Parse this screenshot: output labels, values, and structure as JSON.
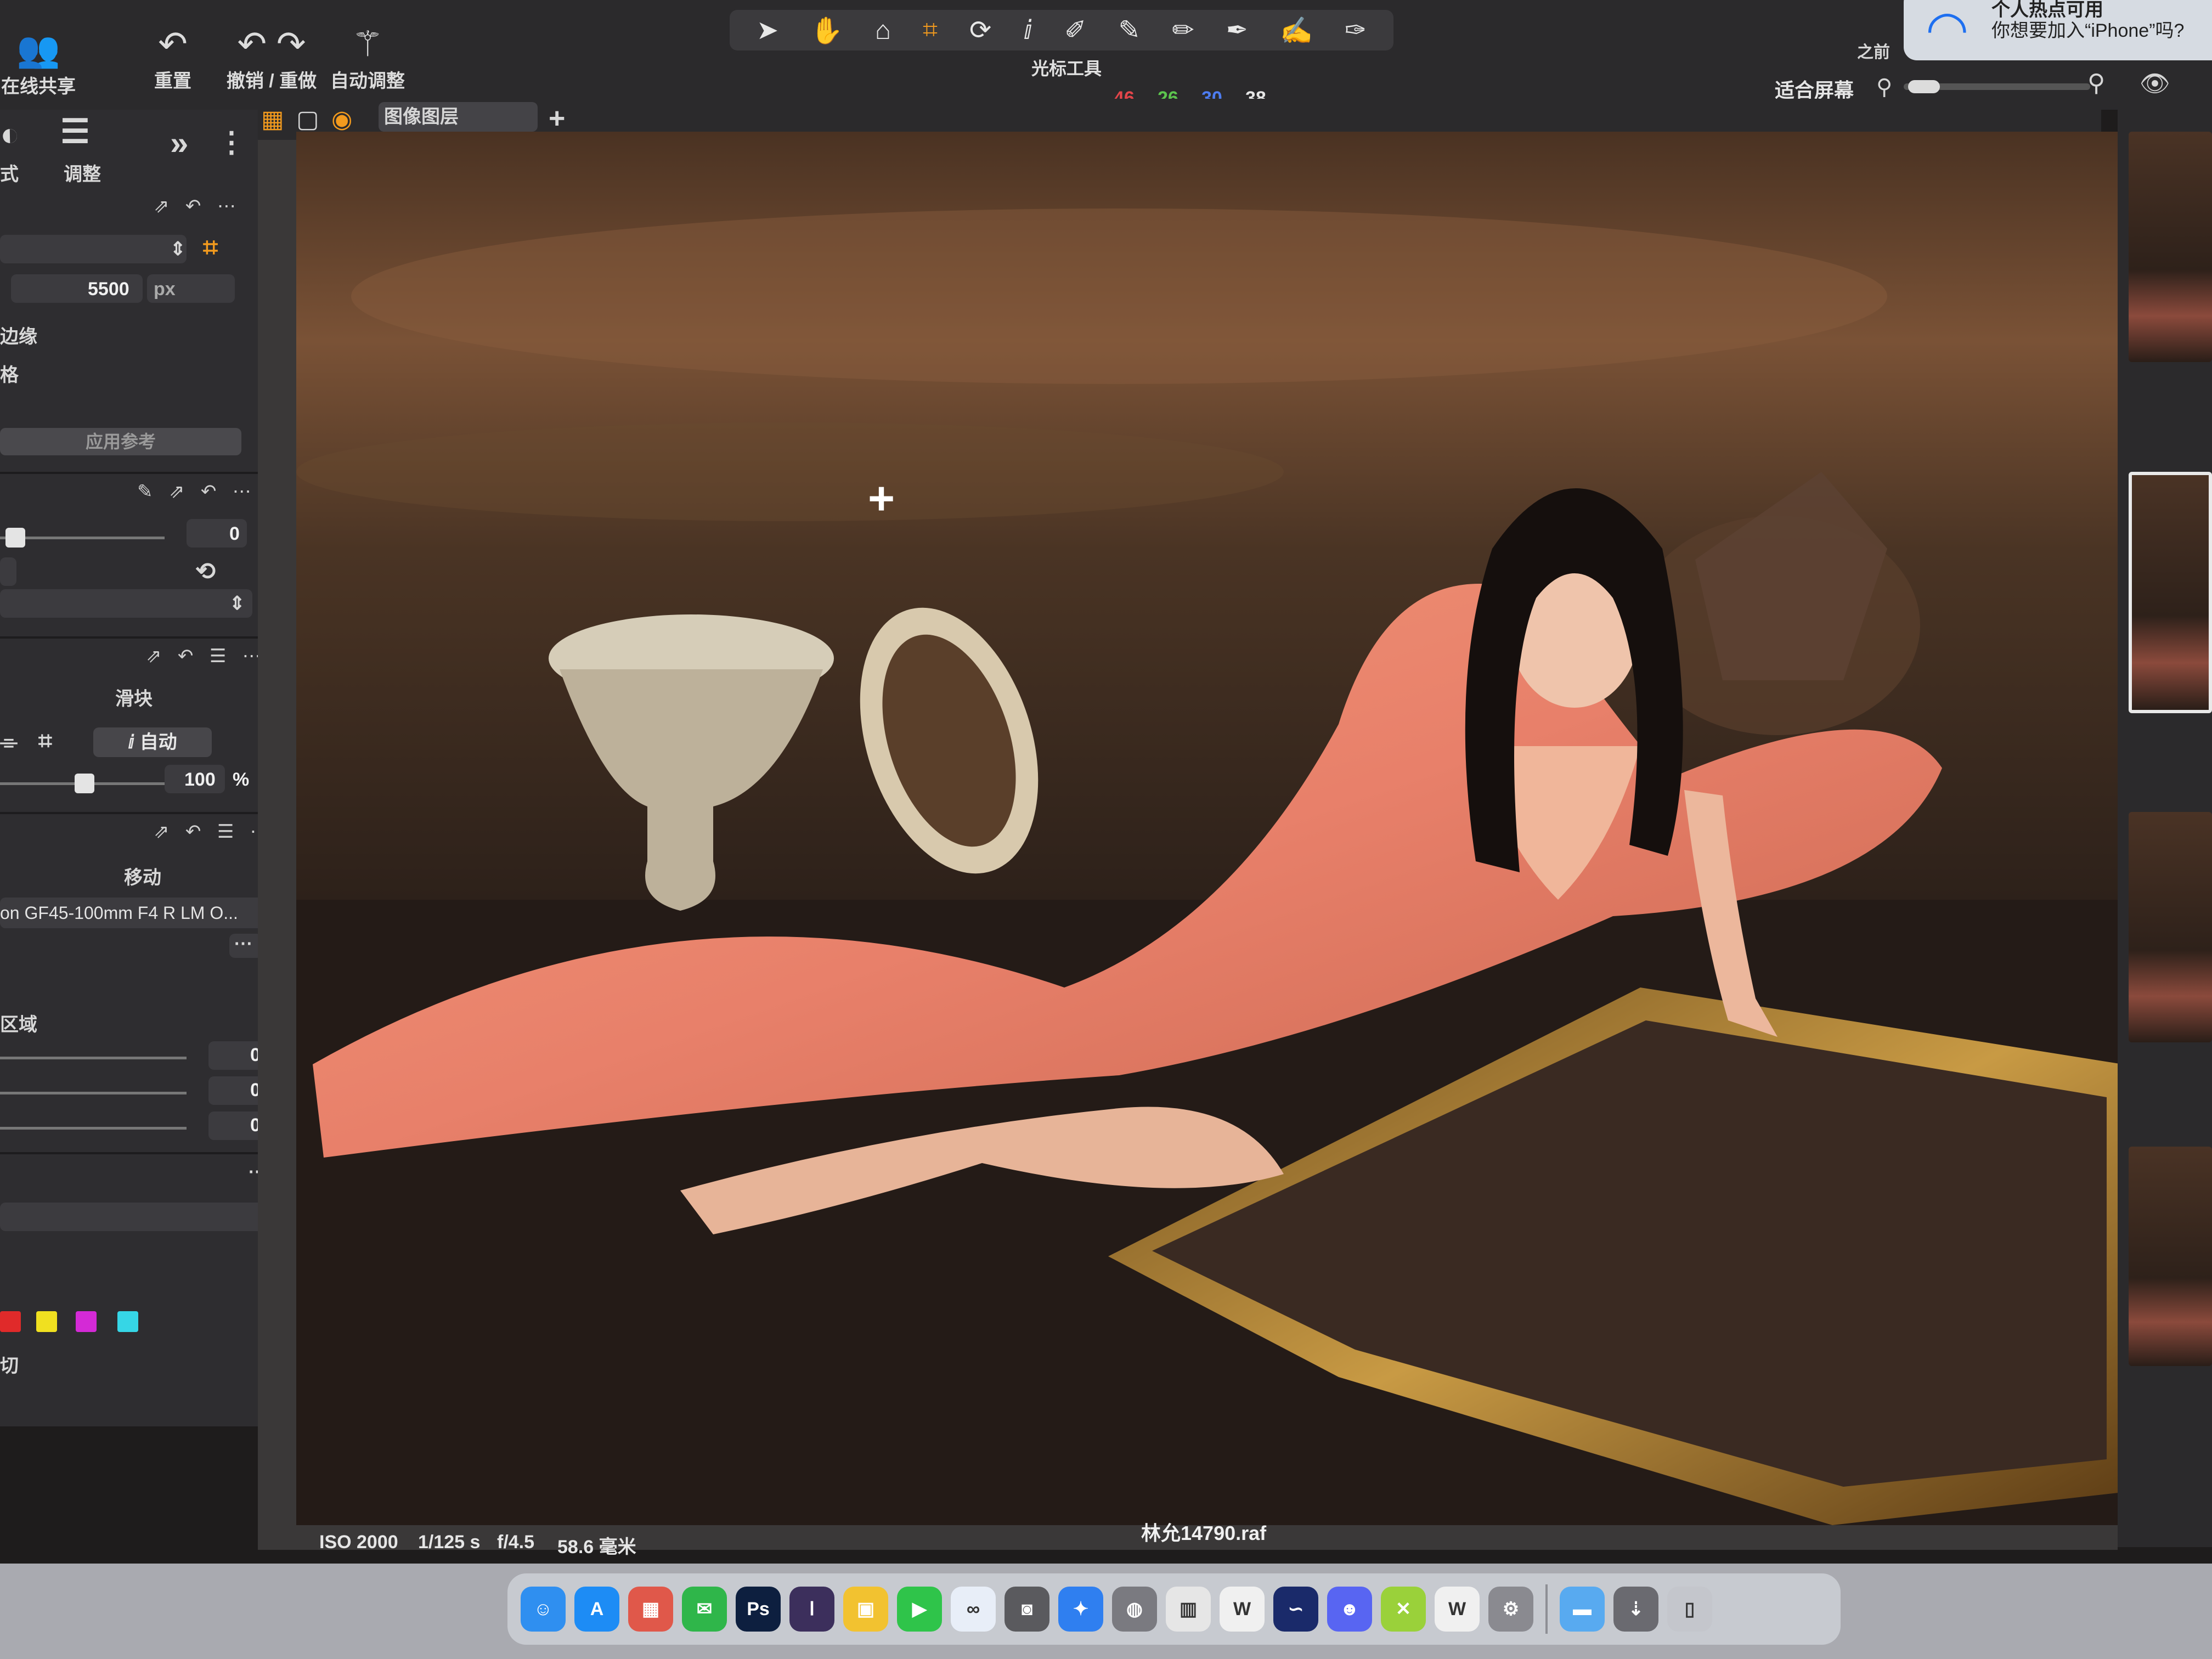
{
  "toolbar": {
    "online_share_label": "在线共享",
    "reset_label": "重置",
    "undo_redo_label": "撤销 / 重做",
    "auto_adjust_label": "自动调整",
    "cursor_tools_label": "光标工具",
    "before_label": "之前",
    "fit_screen_label": "适合屏幕",
    "counts": [
      "46",
      "26",
      "30",
      "38"
    ],
    "count_colors": [
      "#e2454a",
      "#5cc44e",
      "#4d7cf0",
      "#e6e6e6"
    ],
    "active_tool": "crop-icon"
  },
  "notification": {
    "title": "个人热点可用",
    "body": "你想要加入“iPhone”吗?"
  },
  "left_panel": {
    "tabs": [
      {
        "label": "式"
      },
      {
        "label": "调整"
      }
    ],
    "crop": {
      "width_value": "5500",
      "unit": "px",
      "row1_label": "边缘",
      "row2_label": "格",
      "apply_button": "应用参考"
    },
    "rotation": {
      "value": "0"
    },
    "keystone": {
      "title": "滑块",
      "auto_label": "自动",
      "amount_value": "100",
      "amount_unit": "%"
    },
    "lens": {
      "title": "移动",
      "lens_name": "on GF45-100mm F4 R LM O...",
      "region_label": "区域",
      "values": [
        "0",
        "0",
        "0"
      ]
    },
    "swatch_colors": [
      "#e02a2a",
      "#f0e020",
      "#d42ad6",
      "#36d6e6"
    ],
    "bottom_label": "切"
  },
  "viewer": {
    "layer_select": "图像图层",
    "filename": "林允14790.raf",
    "iso": "ISO 2000",
    "shutter": "1/125 s",
    "aperture": "f/4.5",
    "focal_length": "58.6 毫米"
  },
  "dock": {
    "apps": [
      {
        "name": "Finder",
        "icon": "finder-icon",
        "color": "#2f8ff0"
      },
      {
        "name": "App Store",
        "icon": "app-store-icon",
        "color": "#1d8cf5"
      },
      {
        "name": "Launchpad",
        "icon": "launchpad-icon",
        "color": "#e0584a"
      },
      {
        "name": "WeChat",
        "icon": "wechat-icon",
        "color": "#2fb64a"
      },
      {
        "name": "Ps",
        "icon": "photoshop-icon",
        "color": "#0d1f3f"
      },
      {
        "name": "Capture One",
        "icon": "capture-one-icon",
        "color": "#3c2f5c"
      },
      {
        "name": "Stacks",
        "icon": "stacks-icon",
        "color": "#f2c230"
      },
      {
        "name": "FaceTime",
        "icon": "facetime-icon",
        "color": "#2fc44a"
      },
      {
        "name": "Baidu",
        "icon": "baidu-icon",
        "color": "#e8eef8"
      },
      {
        "name": "Screenshot",
        "icon": "screenshot-icon",
        "color": "#5a5a5e"
      },
      {
        "name": "Safari",
        "icon": "safari-icon",
        "color": "#2f7ff0"
      },
      {
        "name": "Preview",
        "icon": "preview-icon",
        "color": "#7a7a80"
      },
      {
        "name": "Calculator",
        "icon": "calculator-icon",
        "color": "#e6e6e6"
      },
      {
        "name": "WPS",
        "icon": "wps-icon",
        "color": "#f0f0f0"
      },
      {
        "name": "Tencent Meeting",
        "icon": "meeting-icon",
        "color": "#1a2a6a"
      },
      {
        "name": "Discord",
        "icon": "discord-icon",
        "color": "#5865f2"
      },
      {
        "name": "App",
        "icon": "app-green-icon",
        "color": "#9ad13a"
      },
      {
        "name": "Weibo",
        "icon": "weibo-icon",
        "color": "#f0f0f0"
      },
      {
        "name": "Settings",
        "icon": "settings-icon",
        "color": "#8a8a90"
      },
      {
        "name": "Folder",
        "icon": "folder-icon",
        "color": "#58aaf0"
      },
      {
        "name": "Downloads",
        "icon": "downloads-icon",
        "color": "#6a6a70"
      },
      {
        "name": "Trash",
        "icon": "trash-icon",
        "color": "#c4c6cc"
      }
    ]
  }
}
